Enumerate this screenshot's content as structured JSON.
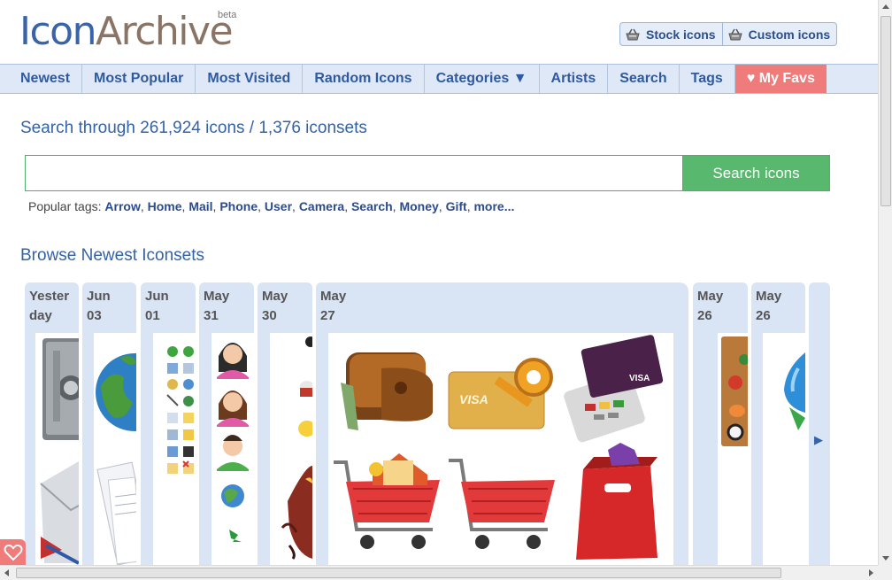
{
  "logo": {
    "icon_text": "Icon",
    "archive_text": "Archive",
    "beta": "beta"
  },
  "top_buttons": [
    {
      "label": "Stock icons"
    },
    {
      "label": "Custom icons"
    }
  ],
  "nav": [
    "Newest",
    "Most Popular",
    "Most Visited",
    "Random Icons",
    "Categories ▼",
    "Artists",
    "Search",
    "Tags",
    "♥ My Favs"
  ],
  "search": {
    "heading": "Search through 261,924 icons / 1,376 iconsets",
    "input_value": "",
    "button_label": "Search icons",
    "tags_label": "Popular tags:",
    "tags": [
      "Arrow",
      "Home",
      "Mail",
      "Phone",
      "User",
      "Camera",
      "Search",
      "Money",
      "Gift",
      "more..."
    ]
  },
  "browse": {
    "heading": "Browse Newest Iconsets",
    "dates": [
      {
        "line1": "Yester",
        "line2": "day"
      },
      {
        "line1": "Jun",
        "line2": "03"
      },
      {
        "line1": "Jun",
        "line2": "01"
      },
      {
        "line1": "May",
        "line2": "31"
      },
      {
        "line1": "May",
        "line2": "30"
      },
      {
        "line1": "May",
        "line2": "27"
      },
      {
        "line1": "May",
        "line2": "26"
      },
      {
        "line1": "May",
        "line2": "26"
      }
    ],
    "next_arrow": "▶"
  },
  "colors": {
    "brand_blue": "#3a63a8",
    "brand_brown": "#8a7466",
    "nav_bg": "#dfe8f6",
    "favs_bg": "#ef7b7b",
    "search_green": "#57b86e",
    "strip_bg": "#d9e4f5"
  }
}
